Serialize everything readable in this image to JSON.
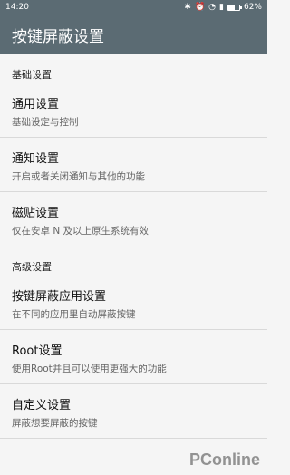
{
  "status_bar": {
    "time": "14:20",
    "battery_text": "62%",
    "battery_level": 0.62,
    "icons": [
      "bluetooth-icon",
      "alarm-off-icon",
      "wifi-icon",
      "signal-icon"
    ]
  },
  "app_bar": {
    "title": "按键屏蔽设置"
  },
  "sections": [
    {
      "header": "基础设置",
      "items": [
        {
          "title": "通用设置",
          "subtitle": "基础设定与控制"
        },
        {
          "title": "通知设置",
          "subtitle": "开启或者关闭通知与其他的功能"
        },
        {
          "title": "磁贴设置",
          "subtitle": "仅在安卓 N 及以上原生系统有效"
        }
      ]
    },
    {
      "header": "高级设置",
      "items": [
        {
          "title": "按键屏蔽应用设置",
          "subtitle": "在不同的应用里自动屏蔽按键"
        },
        {
          "title": "Root设置",
          "subtitle": "使用Root并且可以使用更强大的功能"
        },
        {
          "title": "自定义设置",
          "subtitle": "屏蔽想要屏蔽的按键"
        }
      ]
    }
  ],
  "watermark": "PConline",
  "colors": {
    "primary": "#5b6b73",
    "background": "#f5f5f5"
  }
}
